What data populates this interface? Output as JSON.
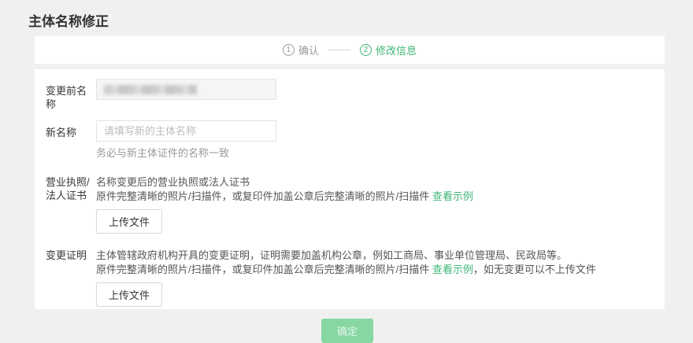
{
  "page": {
    "title": "主体名称修正"
  },
  "stepper": {
    "step1": {
      "number": "1",
      "label": "确认"
    },
    "step2": {
      "number": "2",
      "label": "修改信息"
    }
  },
  "form": {
    "before_name": {
      "label": "变更前名称",
      "value_redacted": true
    },
    "new_name": {
      "label": "新名称",
      "placeholder": "请填写新的主体名称",
      "value": "",
      "helper": "务必与新主体证件的名称一致"
    },
    "license": {
      "label_line1": "营业执照/",
      "label_line2": "法人证书",
      "desc_line1": "名称变更后的营业执照或法人证书",
      "desc_line2": "原件完整清晰的照片/扫描件，或复印件加盖公章后完整清晰的照片/扫描件 ",
      "example_link": "查看示例",
      "upload_label": "上传文件"
    },
    "change_proof": {
      "label": "变更证明",
      "desc_line1": "主体管辖政府机构开具的变更证明，证明需要加盖机构公章，例如工商局、事业单位管理局、民政局等。",
      "desc_line2_prefix": "原件完整清晰的照片/扫描件，或复印件加盖公章后完整清晰的照片/扫描件 ",
      "example_link": "查看示例",
      "desc_line2_suffix": "，如无变更可以不上传文件",
      "upload_label": "上传文件"
    },
    "submit_label": "确定"
  },
  "colors": {
    "accent_green": "#3eb575",
    "submit_disabled_bg": "#87d7a3",
    "page_bg": "#f0f0f1"
  }
}
